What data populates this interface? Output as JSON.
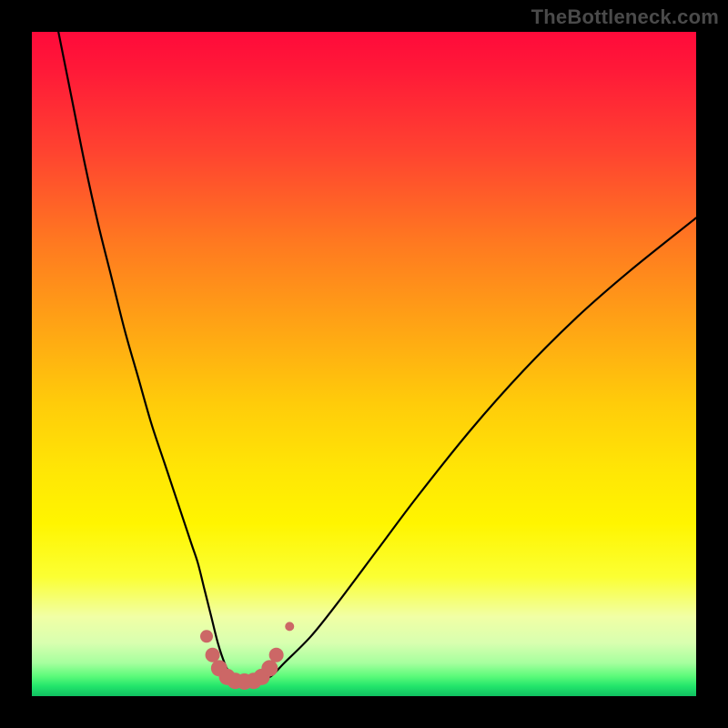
{
  "watermark": "TheBottleneck.com",
  "chart_data": {
    "type": "line",
    "title": "",
    "xlabel": "",
    "ylabel": "",
    "xlim": [
      0,
      100
    ],
    "ylim": [
      0,
      100
    ],
    "grid": false,
    "legend": false,
    "gradient_stops": [
      {
        "pos": 0,
        "color": "#ff0a3a"
      },
      {
        "pos": 18,
        "color": "#ff4330"
      },
      {
        "pos": 44,
        "color": "#ffa315"
      },
      {
        "pos": 66,
        "color": "#ffe605"
      },
      {
        "pos": 88,
        "color": "#f1ffa5"
      },
      {
        "pos": 97,
        "color": "#5cfb7a"
      },
      {
        "pos": 100,
        "color": "#0fc061"
      }
    ],
    "series": [
      {
        "name": "bottleneck-curve",
        "stroke": "#000000",
        "x": [
          4,
          6,
          8,
          10,
          12,
          14,
          16,
          18,
          20,
          22,
          24,
          25,
          26,
          27,
          28,
          29,
          30,
          31,
          32,
          33,
          34,
          36,
          38,
          42,
          46,
          52,
          58,
          66,
          74,
          82,
          90,
          100
        ],
        "y": [
          100,
          90,
          80,
          71,
          63,
          55,
          48,
          41,
          35,
          29,
          23,
          20,
          16,
          12,
          8,
          5,
          3,
          2.2,
          2,
          2,
          2.2,
          3,
          5,
          9,
          14,
          22,
          30,
          40,
          49,
          57,
          64,
          72
        ]
      },
      {
        "name": "highlight-dots",
        "stroke": "#cc6766",
        "marker": "circle",
        "x": [
          26.3,
          27.2,
          28.2,
          29.4,
          30.6,
          32.0,
          33.4,
          34.6,
          35.8,
          36.8,
          38.8
        ],
        "y": [
          9.0,
          6.2,
          4.2,
          2.9,
          2.3,
          2.2,
          2.3,
          2.9,
          4.2,
          6.2,
          10.5
        ],
        "r": [
          7,
          8,
          9,
          9,
          9,
          9,
          9,
          9,
          9,
          8,
          5
        ]
      }
    ]
  }
}
